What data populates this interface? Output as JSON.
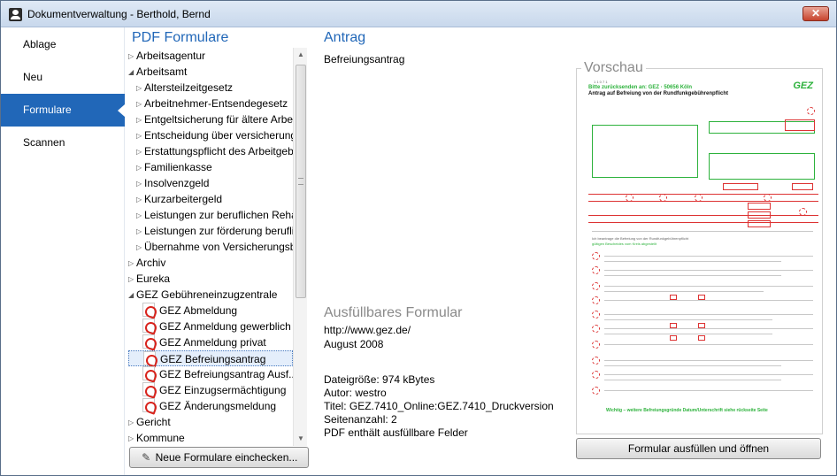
{
  "window": {
    "title": "Dokumentverwaltung - Berthold, Bernd",
    "close_glyph": "✕"
  },
  "nav": {
    "items": [
      {
        "label": "Ablage",
        "active": false
      },
      {
        "label": "Neu",
        "active": false
      },
      {
        "label": "Formulare",
        "active": true
      },
      {
        "label": "Scannen",
        "active": false
      }
    ]
  },
  "headers": {
    "pdf_formulare": "PDF Formulare",
    "antrag": "Antrag",
    "vorschau": "Vorschau",
    "ausfuellbares": "Ausfüllbares Formular"
  },
  "tree": {
    "items": [
      {
        "label": "Arbeitsagentur",
        "level": 0,
        "kind": "folder",
        "expanded": false
      },
      {
        "label": "Arbeitsamt",
        "level": 0,
        "kind": "folder",
        "expanded": true
      },
      {
        "label": "Altersteilzeitgesetz",
        "level": 1,
        "kind": "folder",
        "expanded": false
      },
      {
        "label": "Arbeitnehmer-Entsendegesetz",
        "level": 1,
        "kind": "folder",
        "expanded": false
      },
      {
        "label": "Entgeltsicherung für ältere Arbei...",
        "level": 1,
        "kind": "folder",
        "expanded": false
      },
      {
        "label": "Entscheidung über versicherung...",
        "level": 1,
        "kind": "folder",
        "expanded": false
      },
      {
        "label": "Erstattungspflicht des Arbeitgeb...",
        "level": 1,
        "kind": "folder",
        "expanded": false
      },
      {
        "label": "Familienkasse",
        "level": 1,
        "kind": "folder",
        "expanded": false
      },
      {
        "label": "Insolvenzgeld",
        "level": 1,
        "kind": "folder",
        "expanded": false
      },
      {
        "label": "Kurzarbeitergeld",
        "level": 1,
        "kind": "folder",
        "expanded": false
      },
      {
        "label": "Leistungen zur beruflichen Reha...",
        "level": 1,
        "kind": "folder",
        "expanded": false
      },
      {
        "label": "Leistungen zur förderung berufli...",
        "level": 1,
        "kind": "folder",
        "expanded": false
      },
      {
        "label": "Übernahme von Versicherungsb...",
        "level": 1,
        "kind": "folder",
        "expanded": false
      },
      {
        "label": "Archiv",
        "level": 0,
        "kind": "folder",
        "expanded": false
      },
      {
        "label": "Eureka",
        "level": 0,
        "kind": "folder",
        "expanded": false
      },
      {
        "label": "GEZ Gebühreneinzugzentrale",
        "level": 0,
        "kind": "folder",
        "expanded": true
      },
      {
        "label": "GEZ Abmeldung",
        "level": 1,
        "kind": "pdf"
      },
      {
        "label": "GEZ Anmeldung gewerblich",
        "level": 1,
        "kind": "pdf"
      },
      {
        "label": "GEZ Anmeldung privat",
        "level": 1,
        "kind": "pdf"
      },
      {
        "label": "GEZ Befreiungsantrag",
        "level": 1,
        "kind": "pdf",
        "selected": true
      },
      {
        "label": "GEZ Befreiungsantrag Ausf...",
        "level": 1,
        "kind": "pdf"
      },
      {
        "label": "GEZ Einzugsermächtigung",
        "level": 1,
        "kind": "pdf"
      },
      {
        "label": "GEZ Änderungsmeldung",
        "level": 1,
        "kind": "pdf"
      },
      {
        "label": "Gericht",
        "level": 0,
        "kind": "folder",
        "expanded": false
      },
      {
        "label": "Kommune",
        "level": 0,
        "kind": "folder",
        "expanded": false
      }
    ]
  },
  "buttons": {
    "checkin": "Neue Formulare einchecken...",
    "open_form": "Formular ausfüllen und öffnen"
  },
  "antrag": {
    "name": "Befreiungsantrag",
    "url": "http://www.gez.de/",
    "date": "August 2008",
    "filesize": "Dateigröße: 974 kBytes",
    "author": "Autor: westro",
    "title": "Titel: GEZ.7410_Online:GEZ.7410_Druckversion",
    "pages": "Seitenanzahl: 2",
    "fillable": "PDF enthält ausfüllbare Felder"
  },
  "preview": {
    "top_line": "Bitte zurücksenden an: GEZ · 50656 Köln",
    "heading": "Antrag auf Befreiung von der Rundfunkgebührenpflicht",
    "logo": "GEZ",
    "footer": "Wichtig – weitere Befreiungsgründe Datum/Unterschrift siehe rückseite Seite"
  },
  "colors": {
    "accent": "#2167b8",
    "gez_green": "#2db23c",
    "gez_red": "#d33333"
  }
}
